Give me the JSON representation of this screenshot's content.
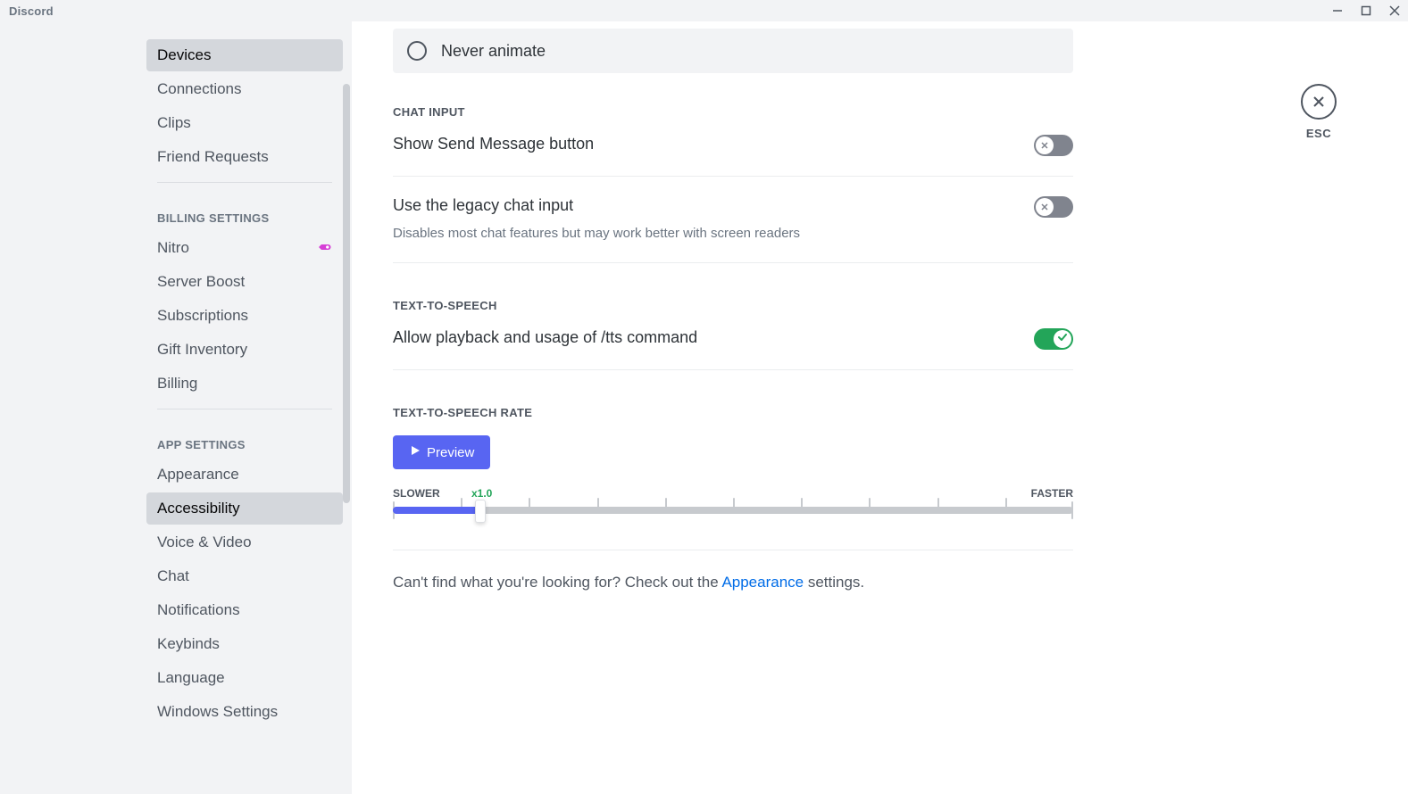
{
  "app_title": "Discord",
  "close_label": "ESC",
  "sidebar": {
    "items": [
      {
        "label": "Devices",
        "selected": true
      },
      {
        "label": "Connections"
      },
      {
        "label": "Clips"
      },
      {
        "label": "Friend Requests"
      }
    ],
    "billing_header": "BILLING SETTINGS",
    "billing_items": [
      {
        "label": "Nitro",
        "icon": "nitro"
      },
      {
        "label": "Server Boost"
      },
      {
        "label": "Subscriptions"
      },
      {
        "label": "Gift Inventory"
      },
      {
        "label": "Billing"
      }
    ],
    "app_header": "APP SETTINGS",
    "app_items": [
      {
        "label": "Appearance"
      },
      {
        "label": "Accessibility",
        "selected": true
      },
      {
        "label": "Voice & Video"
      },
      {
        "label": "Chat"
      },
      {
        "label": "Notifications"
      },
      {
        "label": "Keybinds"
      },
      {
        "label": "Language"
      },
      {
        "label": "Windows Settings"
      }
    ]
  },
  "radio": {
    "never_animate": "Never animate"
  },
  "sections": {
    "chat_input_header": "CHAT INPUT",
    "show_send_button": "Show Send Message button",
    "legacy_chat_title": "Use the legacy chat input",
    "legacy_chat_desc": "Disables most chat features but may work better with screen readers",
    "tts_header": "TEXT-TO-SPEECH",
    "tts_allow": "Allow playback and usage of /tts command",
    "tts_rate_header": "TEXT-TO-SPEECH RATE",
    "preview_btn": "Preview",
    "slider_slower": "SLOWER",
    "slider_faster": "FASTER",
    "slider_current": "x1.0"
  },
  "footer": {
    "pre": "Can't find what you're looking for? Check out the ",
    "link": "Appearance",
    "post": " settings."
  }
}
